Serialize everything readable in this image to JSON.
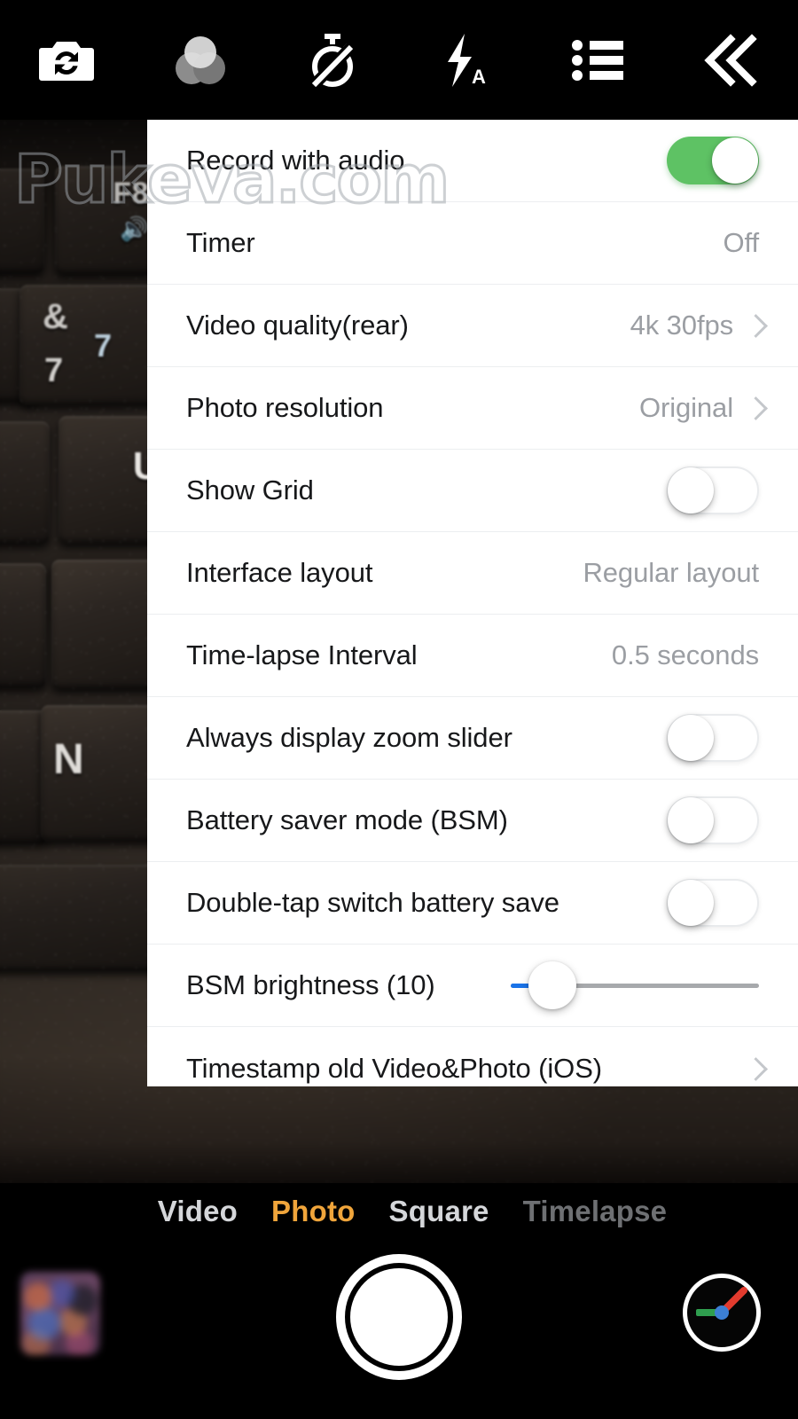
{
  "app": {
    "name": "Camera",
    "watermark": "Pukeva.com"
  },
  "toolbar": {
    "items": [
      {
        "name": "switch-camera-icon",
        "label": "Switch camera"
      },
      {
        "name": "filters-icon",
        "label": "Filters"
      },
      {
        "name": "timer-off-icon",
        "label": "Timer off"
      },
      {
        "name": "flash-auto-icon",
        "label": "Flash auto"
      },
      {
        "name": "settings-list-icon",
        "label": "Settings"
      },
      {
        "name": "collapse-left-icon",
        "label": "Collapse"
      }
    ]
  },
  "settings": {
    "rows": [
      {
        "label": "Record with audio",
        "control": "toggle",
        "value": "on"
      },
      {
        "label": "Timer",
        "control": "value",
        "value": "Off"
      },
      {
        "label": "Video quality(rear)",
        "control": "value-chevron",
        "value": "4k 30fps"
      },
      {
        "label": "Photo resolution",
        "control": "value-chevron",
        "value": "Original"
      },
      {
        "label": "Show Grid",
        "control": "toggle",
        "value": "off"
      },
      {
        "label": "Interface layout",
        "control": "value",
        "value": "Regular layout"
      },
      {
        "label": "Time-lapse Interval",
        "control": "value",
        "value": "0.5 seconds"
      },
      {
        "label": "Always display zoom slider",
        "control": "toggle",
        "value": "off"
      },
      {
        "label": "Battery saver mode (BSM)",
        "control": "toggle",
        "value": "off"
      },
      {
        "label": "Double-tap switch battery save",
        "control": "toggle",
        "value": "off"
      },
      {
        "label": "BSM brightness (10)",
        "control": "slider",
        "value": "10"
      },
      {
        "label": "Timestamp old Video&Photo (iOS)",
        "control": "chevron",
        "value": ""
      }
    ]
  },
  "modes": {
    "items": [
      {
        "label": "Video",
        "state": "inactive"
      },
      {
        "label": "Photo",
        "state": "active"
      },
      {
        "label": "Square",
        "state": "inactive"
      },
      {
        "label": "Timelapse",
        "state": "dim"
      }
    ]
  },
  "bottom": {
    "thumbnail_label": "Last photo",
    "shutter_label": "Shutter",
    "gauge_label": "Level gauge"
  },
  "colors": {
    "toggle_on": "#5ec264",
    "accent_mode": "#f0a53b",
    "slider_fill": "#1a73e8",
    "slider_track": "#a7a9ac",
    "panel_bg": "#ffffff",
    "label_text": "#17181a",
    "value_text": "#9b9ea3"
  },
  "preview": {
    "subject": "laptop keyboard close-up",
    "keys": [
      "F8",
      "&",
      "7",
      "7",
      "U",
      "N"
    ]
  }
}
